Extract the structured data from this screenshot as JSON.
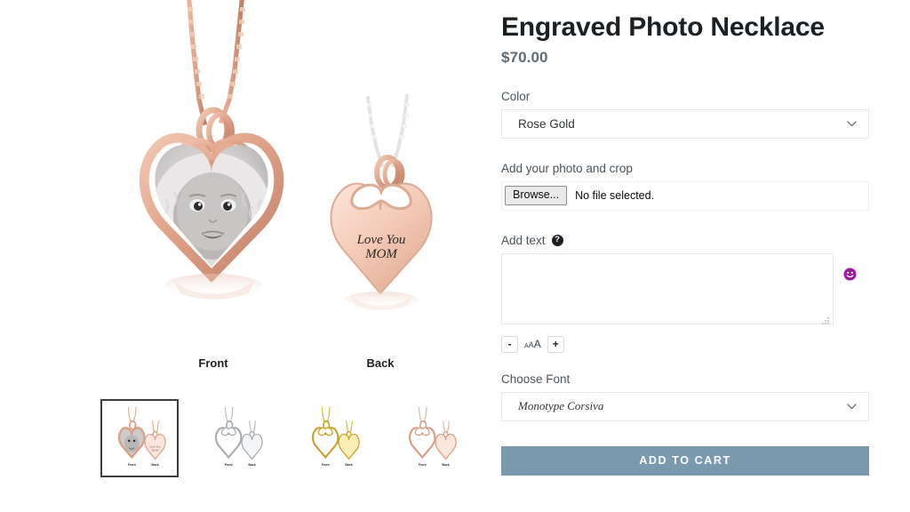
{
  "product": {
    "title": "Engraved Photo Necklace",
    "price": "$70.00"
  },
  "color_field": {
    "label": "Color",
    "selected": "Rose Gold",
    "chevron_icon": "chevron-down-icon"
  },
  "photo_field": {
    "label": "Add your photo and crop",
    "browse_label": "Browse...",
    "file_status": "No file selected."
  },
  "text_field": {
    "label": "Add text",
    "help_icon_glyph": "?",
    "value": "",
    "placeholder": "",
    "emoji_icon": "smiley-face-icon",
    "emoji_color": "#9b1c9b"
  },
  "font_size_controls": {
    "decrease_label": "-",
    "increase_label": "+",
    "indicator_small": "A",
    "indicator_medium": "A",
    "indicator_large": "A"
  },
  "font_field": {
    "label": "Choose Font",
    "selected": "Monotype Corsiva",
    "chevron_icon": "chevron-down-icon"
  },
  "cart": {
    "label": "ADD TO CART",
    "color": "#7b99ad"
  },
  "hero": {
    "front_label": "Front",
    "back_label": "Back",
    "engraving_line1": "Love You",
    "engraving_line2": "MOM",
    "metal_color": "#d99f85"
  },
  "thumbnails": [
    {
      "name": "rose-gold-photo",
      "selected": true,
      "metal": "#d99f85",
      "fill": "#fbe5dc",
      "has_photo": true
    },
    {
      "name": "silver",
      "selected": false,
      "metal": "#9fa4a8",
      "fill": "#f4f5f6",
      "has_photo": false
    },
    {
      "name": "gold",
      "selected": false,
      "metal": "#c9a227",
      "fill": "#fbeeb8",
      "has_photo": false
    },
    {
      "name": "rose-gold",
      "selected": false,
      "metal": "#d99f85",
      "fill": "#fbe5dc",
      "has_photo": false
    }
  ]
}
